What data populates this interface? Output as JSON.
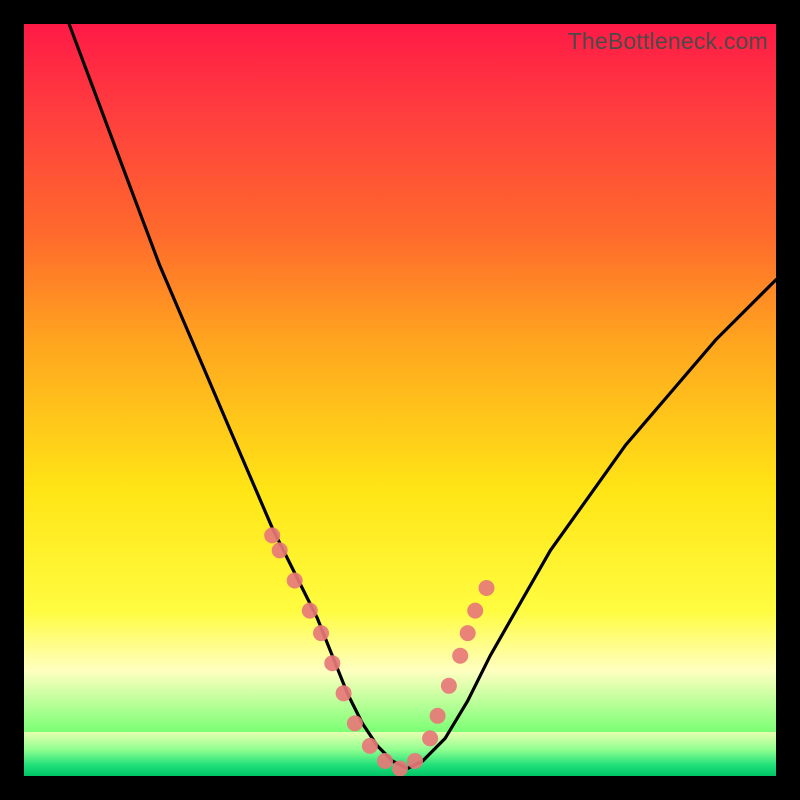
{
  "attribution": "TheBottleneck.com",
  "colors": {
    "frame": "#000000",
    "curve": "#000000",
    "dot_fill": "#e77878",
    "dot_stroke": "#e77878",
    "gradient_stops": [
      "#ff1a46",
      "#ff3e3e",
      "#ff6a2c",
      "#ffa41f",
      "#ffe516",
      "#fffc40",
      "#ffffc0",
      "#6dff6d",
      "#00d66b"
    ]
  },
  "chart_data": {
    "type": "line",
    "title": "",
    "xlabel": "",
    "ylabel": "",
    "xlim": [
      0,
      100
    ],
    "ylim": [
      0,
      100
    ],
    "legend": false,
    "grid": false,
    "series": [
      {
        "name": "bottleneck-curve",
        "x": [
          6,
          9,
          12,
          15,
          18,
          21,
          24,
          27,
          30,
          33,
          36,
          39,
          41,
          43,
          45,
          47,
          49,
          51,
          53,
          56,
          59,
          62,
          66,
          70,
          75,
          80,
          86,
          92,
          100
        ],
        "y": [
          100,
          92,
          84,
          76,
          68,
          61,
          54,
          47,
          40,
          33,
          27,
          21,
          16,
          11,
          7,
          4,
          2,
          1,
          2,
          5,
          10,
          16,
          23,
          30,
          37,
          44,
          51,
          58,
          66
        ]
      }
    ],
    "dots": {
      "name": "highlighted-points",
      "x": [
        33,
        34,
        36,
        38,
        39.5,
        41,
        42.5,
        44,
        46,
        48,
        50,
        52,
        54,
        55,
        56.5,
        58,
        59,
        60,
        61.5
      ],
      "y": [
        32,
        30,
        26,
        22,
        19,
        15,
        11,
        7,
        4,
        2,
        1,
        2,
        5,
        8,
        12,
        16,
        19,
        22,
        25
      ]
    }
  }
}
